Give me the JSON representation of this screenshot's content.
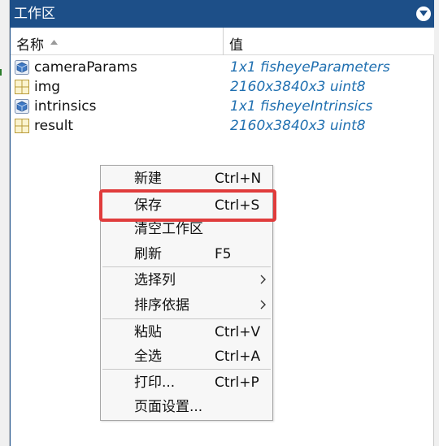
{
  "panel": {
    "title": "工作区",
    "menu_icon": "circle-chevron-down-icon"
  },
  "table": {
    "headers": {
      "name": "名称",
      "value": "值"
    },
    "sort_icon": "sort-ascending-icon",
    "rows": [
      {
        "name": "cameraParams",
        "value": "1x1 fisheyeParameters",
        "icon": "object-icon"
      },
      {
        "name": "img",
        "value": "2160x3840x3 uint8",
        "icon": "matrix-icon"
      },
      {
        "name": "intrinsics",
        "value": "1x1 fisheyeIntrinsics",
        "icon": "object-icon"
      },
      {
        "name": "result",
        "value": "2160x3840x3 uint8",
        "icon": "matrix-icon"
      }
    ]
  },
  "context_menu": {
    "items": [
      {
        "label": "新建",
        "shortcut": "Ctrl+N"
      },
      {
        "label": "保存",
        "shortcut": "Ctrl+S"
      },
      {
        "label": "清空工作区",
        "shortcut": ""
      },
      {
        "label": "刷新",
        "shortcut": "F5"
      },
      {
        "label": "选择列",
        "shortcut": "",
        "submenu": true
      },
      {
        "label": "排序依据",
        "shortcut": "",
        "submenu": true
      },
      {
        "label": "粘贴",
        "shortcut": "Ctrl+V"
      },
      {
        "label": "全选",
        "shortcut": "Ctrl+A"
      },
      {
        "label": "打印...",
        "shortcut": "Ctrl+P"
      },
      {
        "label": "页面设置...",
        "shortcut": ""
      }
    ]
  },
  "colors": {
    "title_bar": "#1d4f88",
    "value_text": "#1f6fb0",
    "highlight_box": "#e03c3c"
  }
}
